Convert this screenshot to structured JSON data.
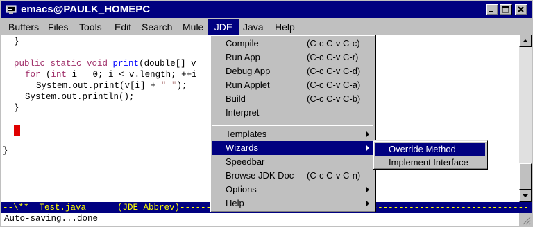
{
  "window": {
    "title": "emacs@PAULK_HOMEPC"
  },
  "menubar": [
    {
      "label": "Buffers"
    },
    {
      "label": "Files"
    },
    {
      "label": "Tools"
    },
    {
      "label": "Edit"
    },
    {
      "label": "Search"
    },
    {
      "label": "Mule"
    },
    {
      "label": "JDE"
    },
    {
      "label": "Java"
    },
    {
      "label": "Help"
    }
  ],
  "code": {
    "l1": "}",
    "l2_kw1": "public static void",
    "l2_fn": "print",
    "l2_rest": "(double[] v",
    "l3_kw1": "for",
    "l3_a": " (",
    "l3_kw2": "int",
    "l3_b": " i = 0; i < v.length; ++i",
    "l4_a": "System.out.print(v[i] + ",
    "l4_str": "\" \"",
    "l4_b": ");",
    "l5": "System.out.println();",
    "l6": "}",
    "l7": "}"
  },
  "jde_menu": {
    "items": [
      {
        "label": "Compile",
        "shortcut": "(C-c C-v C-c)"
      },
      {
        "label": "Run App",
        "shortcut": "(C-c C-v C-r)"
      },
      {
        "label": "Debug App",
        "shortcut": "(C-c C-v C-d)"
      },
      {
        "label": "Run Applet",
        "shortcut": "(C-c C-v C-a)"
      },
      {
        "label": "Build",
        "shortcut": "(C-c C-v C-b)"
      },
      {
        "label": "Interpret",
        "shortcut": ""
      },
      {
        "label": "Templates",
        "shortcut": ""
      },
      {
        "label": "Wizards",
        "shortcut": ""
      },
      {
        "label": "Speedbar",
        "shortcut": ""
      },
      {
        "label": "Browse JDK Doc",
        "shortcut": "(C-c C-v C-n)"
      },
      {
        "label": "Options",
        "shortcut": ""
      },
      {
        "label": "Help",
        "shortcut": ""
      }
    ]
  },
  "wizards_submenu": {
    "items": [
      {
        "label": "Override Method"
      },
      {
        "label": "Implement Interface"
      }
    ]
  },
  "modeline": {
    "text": "--\\**  Test.java      (JDE Abbrev)-------------------------------------------------------------------"
  },
  "minibuffer": {
    "text": "Auto-saving...done"
  },
  "colors": {
    "titlebar": "#000080",
    "menu_highlight": "#000080",
    "cursor": "#e00000",
    "keyword": "#a0306a",
    "function": "#0000ff",
    "modeline_text": "#ffff00"
  }
}
